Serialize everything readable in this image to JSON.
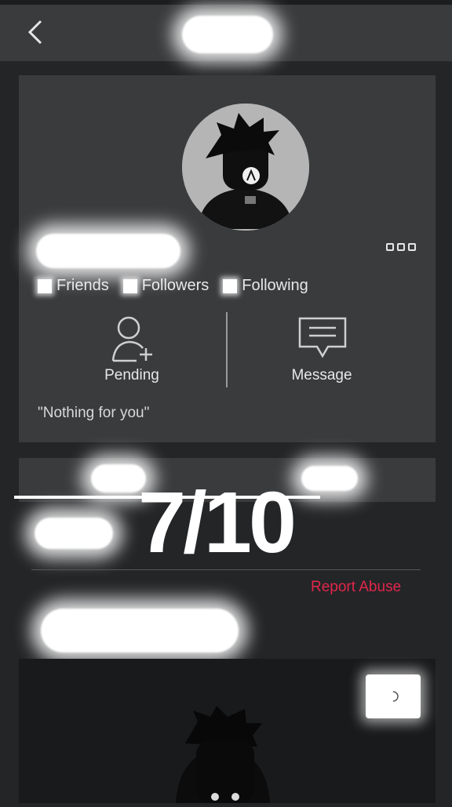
{
  "profile": {
    "stats": [
      {
        "label": "Friends"
      },
      {
        "label": "Followers"
      },
      {
        "label": "Following"
      }
    ],
    "actions": {
      "add_friend_label": "Pending",
      "message_label": "Message"
    },
    "blurb": "\"Nothing for you\""
  },
  "overlay": {
    "rating": "7/10"
  },
  "footer": {
    "report_label": "Report Abuse"
  },
  "colors": {
    "background": "#232527",
    "card": "#393b3d",
    "report": "#e2264b"
  },
  "icons": [
    "back-arrow-icon",
    "more-options-icon",
    "add-friend-icon",
    "message-icon",
    "loading-icon"
  ]
}
